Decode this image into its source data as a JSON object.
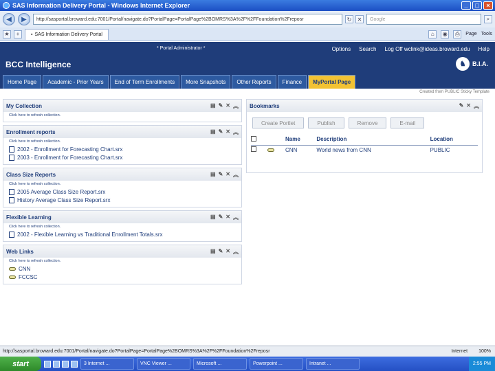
{
  "window": {
    "title": "SAS Information Delivery Portal - Windows Internet Explorer"
  },
  "browser": {
    "address": "http://sasportal.broward.edu:7001/Portal/navigate.do?PortalPage=PortalPage%2BOMRS%3A%2F%2FFoundation%2Freposr",
    "search_placeholder": "Google",
    "tab_label": "SAS Information Delivery Portal",
    "cmd_page": "Page",
    "cmd_tools": "Tools"
  },
  "portal": {
    "admin_label": "* Portal Administrator *",
    "links": {
      "options": "Options",
      "search": "Search",
      "logoff": "Log Off wclink@ideas.broward.edu",
      "help": "Help"
    },
    "brand": "BCC Intelligence",
    "bia": "B.I.A.",
    "tabs": [
      "Home Page",
      "Academic - Prior Years",
      "End of Term Enrollments",
      "More Snapshots",
      "Other Reports",
      "Finance",
      "MyPortal Page"
    ],
    "created_from": "Created from PUBLIC Sticky Template"
  },
  "portlets": {
    "refresh": "Click here to refresh collection.",
    "my_collection": {
      "title": "My Collection"
    },
    "enrollment": {
      "title": "Enrollment reports",
      "items": [
        "2002 - Enrollment for Forecasting Chart.srx",
        "2003 - Enrollment for Forecasting Chart.srx"
      ]
    },
    "class_size": {
      "title": "Class Size Reports",
      "items": [
        "2005 Average Class Size Report.srx",
        "History Average Class Size Report.srx"
      ]
    },
    "flexible": {
      "title": "Flexible Learning",
      "items": [
        "2002 - Flexible Learning vs Traditional Enrollment Totals.srx"
      ]
    },
    "weblinks": {
      "title": "Web Links",
      "items": [
        "CNN",
        "FCCSC"
      ]
    }
  },
  "bookmarks": {
    "title": "Bookmarks",
    "buttons": {
      "create": "Create Portlet",
      "publish": "Publish",
      "remove": "Remove",
      "email": "E-mail"
    },
    "headers": {
      "name": "Name",
      "description": "Description",
      "location": "Location"
    },
    "rows": [
      {
        "name": "CNN",
        "description": "World news from CNN",
        "location": "PUBLIC"
      }
    ]
  },
  "status": {
    "url": "http://sasportal.broward.edu:7001/Portal/navigate.do?PortalPage=PortalPage%2BOMRS%3A%2F%2FFoundation%2Freposr",
    "zone": "Internet",
    "zoom": "100%"
  },
  "taskbar": {
    "start": "start",
    "tasks": [
      "3 Internet ...",
      "VNC Viewer ...",
      "Microsoft ...",
      "Powerpoint ...",
      "Intranet ..."
    ],
    "clock": "2:55 PM"
  }
}
